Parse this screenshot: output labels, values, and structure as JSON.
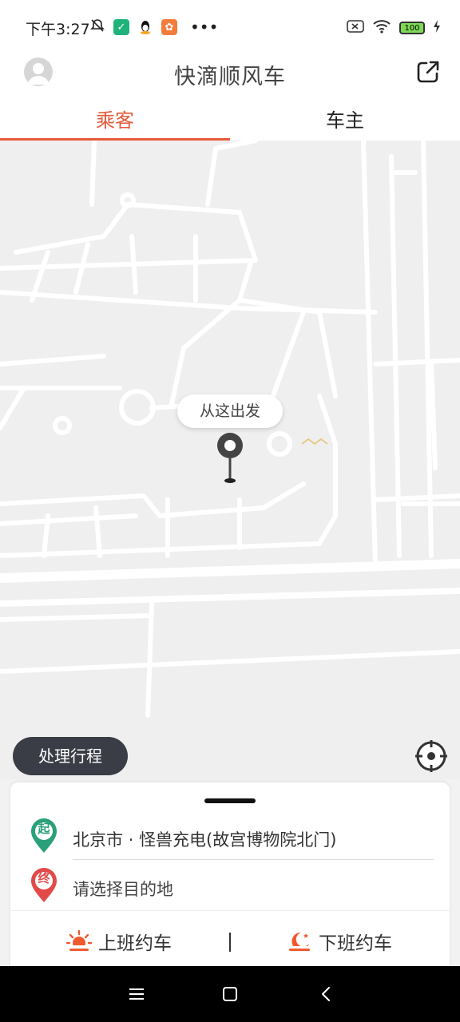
{
  "status_bar": {
    "time": "下午3:27",
    "battery": "100"
  },
  "header": {
    "title": "快滴顺风车"
  },
  "tabs": [
    {
      "label": "乘客",
      "active": true
    },
    {
      "label": "车主",
      "active": false
    }
  ],
  "map": {
    "start_bubble": "从这出发"
  },
  "trip_chip": "处理行程",
  "card": {
    "start_icon_label": "起",
    "end_icon_label": "终",
    "start_address": "北京市 · 怪兽充电(故宫博物院北门)",
    "destination_placeholder": "请选择目的地",
    "action_left": "上班约车",
    "action_right": "下班约车"
  },
  "colors": {
    "accent": "#e55a3a",
    "start_pin": "#2aa07a",
    "end_pin": "#e24a4a",
    "chip_bg": "#3a3d45"
  }
}
